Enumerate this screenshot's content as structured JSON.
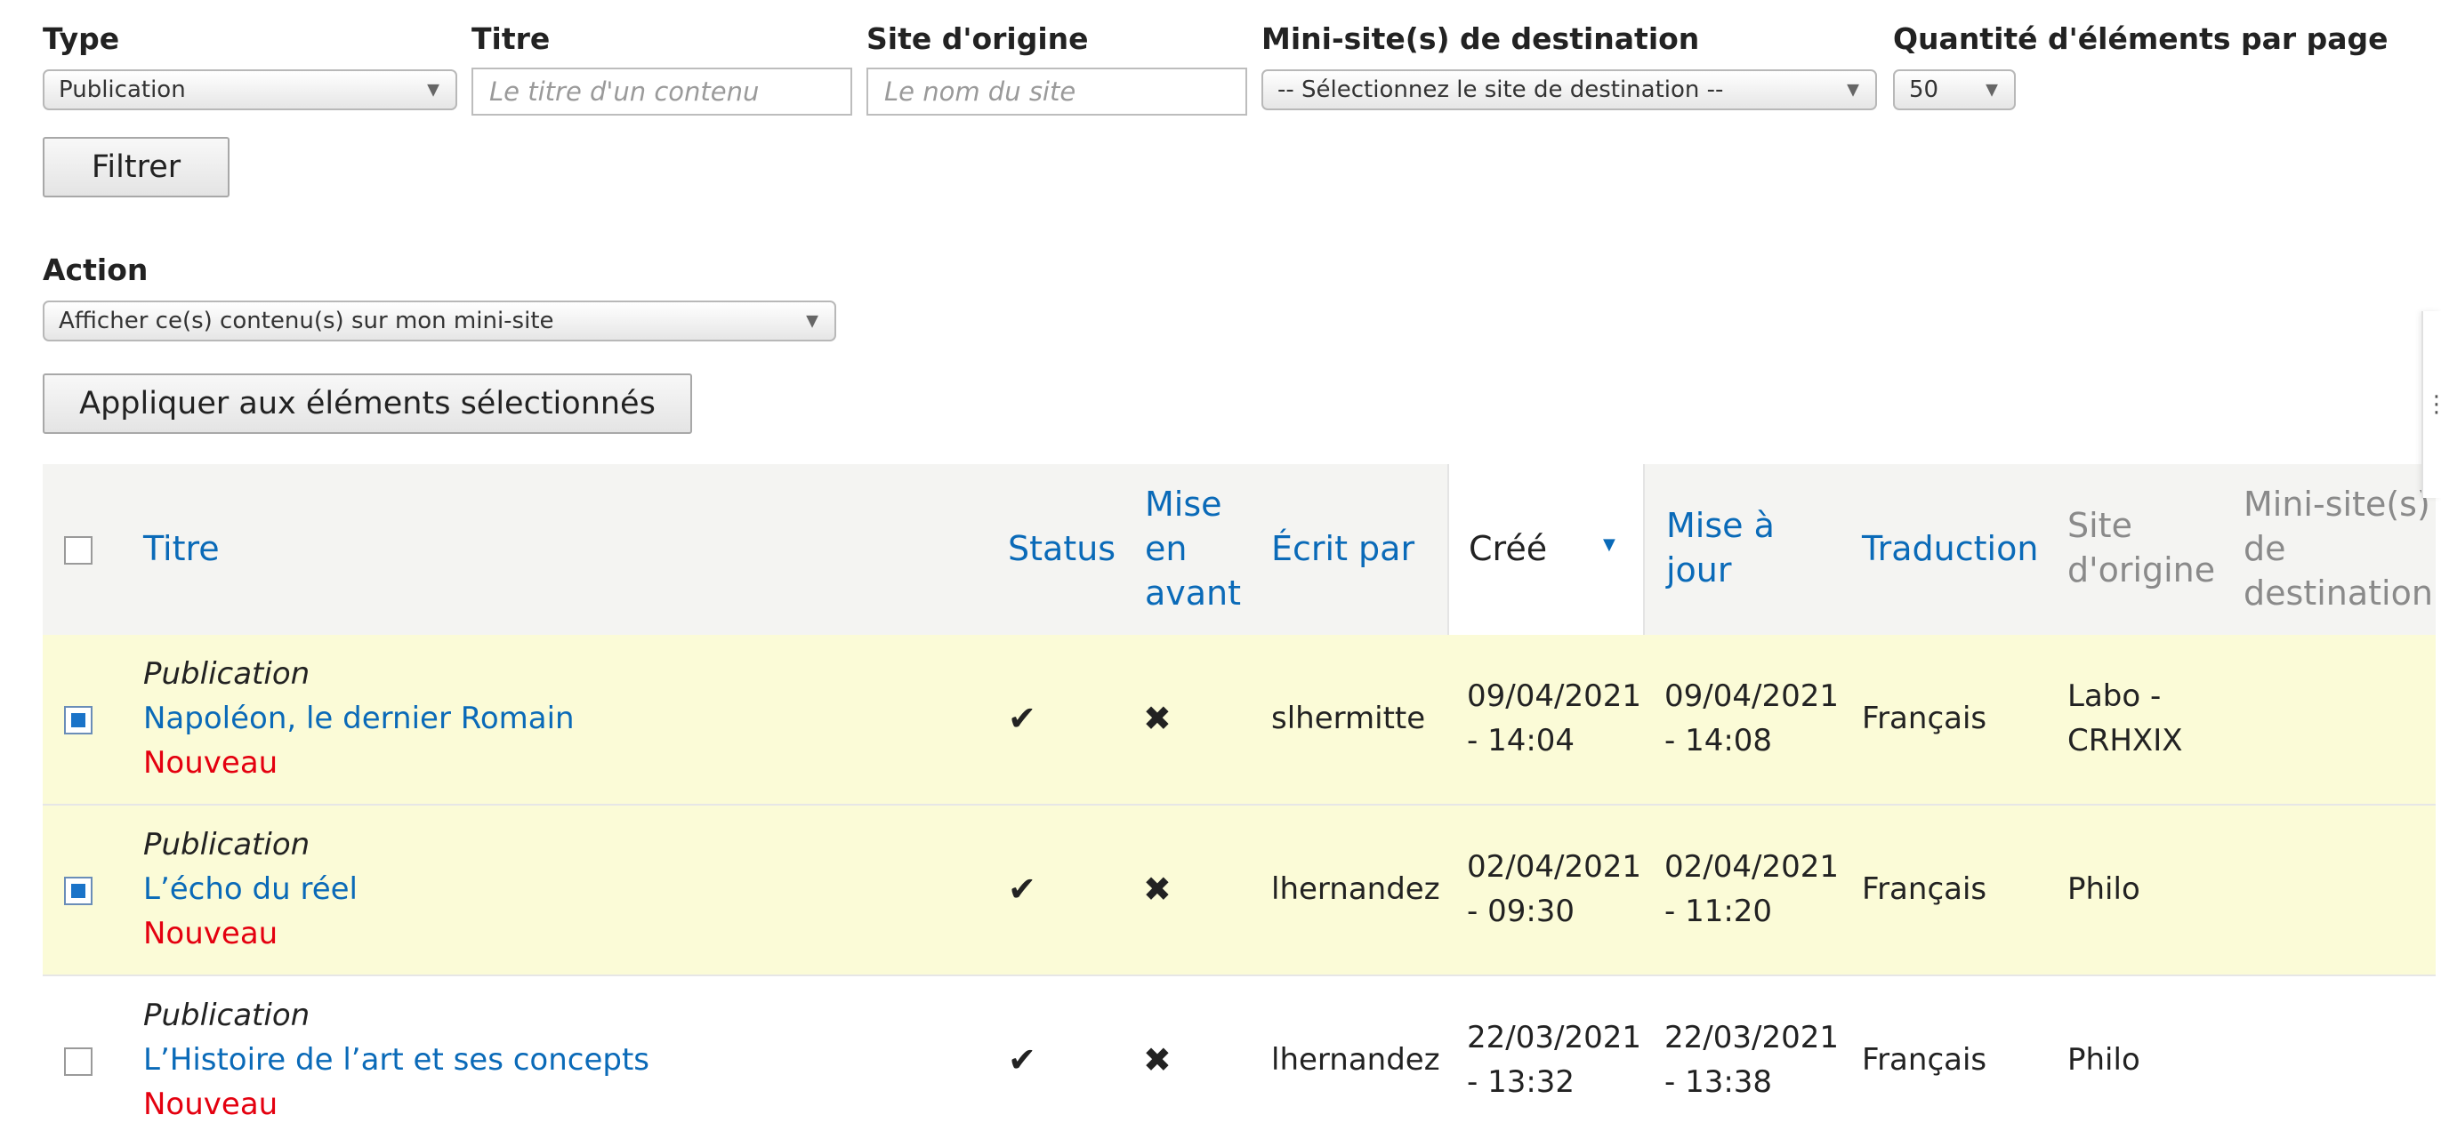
{
  "filters": {
    "type": {
      "label": "Type",
      "value": "Publication"
    },
    "title": {
      "label": "Titre",
      "placeholder": "Le titre d'un contenu"
    },
    "origin": {
      "label": "Site d'origine",
      "placeholder": "Le nom du site"
    },
    "destination": {
      "label": "Mini-site(s) de destination",
      "value": "-- Sélectionnez le site de destination --"
    },
    "per_page": {
      "label": "Quantité d'éléments par page",
      "value": "50"
    },
    "filter_button": "Filtrer"
  },
  "action": {
    "label": "Action",
    "value": "Afficher ce(s) contenu(s) sur mon mini-site",
    "apply_button": "Appliquer aux éléments sélectionnés"
  },
  "table": {
    "headers": {
      "title": "Titre",
      "status": "Status",
      "featured": [
        "Mise",
        "en",
        "avant"
      ],
      "author": "Écrit par",
      "created": "Créé",
      "updated": [
        "Mise à",
        "jour"
      ],
      "translation": "Traduction",
      "origin": [
        "Site",
        "d'origine"
      ],
      "destination": [
        "Mini-site(s)",
        "de",
        "destination"
      ]
    },
    "sorted_column": "created",
    "rows": [
      {
        "checked": true,
        "type": "Publication",
        "title": "Napoléon, le dernier Romain",
        "badge": "Nouveau",
        "status": "✔",
        "featured": "✖",
        "author": "slhermitte",
        "created": [
          "09/04/2021",
          "- 14:04"
        ],
        "updated": [
          "09/04/2021",
          "- 14:08"
        ],
        "translation": "Français",
        "origin": [
          "Labo -",
          "CRHXIX"
        ],
        "destination": ""
      },
      {
        "checked": true,
        "type": "Publication",
        "title": "L’écho du réel",
        "badge": "Nouveau",
        "status": "✔",
        "featured": "✖",
        "author": "lhernandez",
        "created": [
          "02/04/2021",
          "- 09:30"
        ],
        "updated": [
          "02/04/2021",
          "- 11:20"
        ],
        "translation": "Français",
        "origin": [
          "Philo"
        ],
        "destination": ""
      },
      {
        "checked": false,
        "type": "Publication",
        "title": "L’Histoire de l’art et ses concepts",
        "badge": "Nouveau",
        "status": "✔",
        "featured": "✖",
        "author": "lhernandez",
        "created": [
          "22/03/2021",
          "- 13:32"
        ],
        "updated": [
          "22/03/2021",
          "- 13:38"
        ],
        "translation": "Français",
        "origin": [
          "Philo"
        ],
        "destination": ""
      }
    ]
  },
  "colors": {
    "link": "#0a6ab8",
    "new": "#e4000f",
    "selected_row": "#fbfbd7",
    "header_bg": "#f4f4f2"
  }
}
